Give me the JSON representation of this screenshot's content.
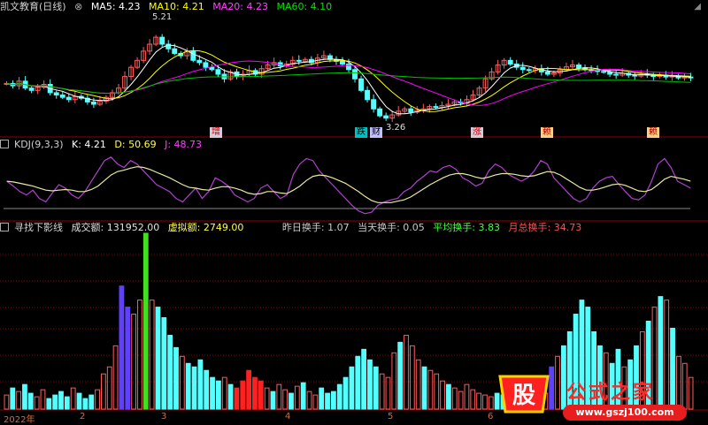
{
  "panel1": {
    "title": "凯文教育(日线)",
    "ma5": "MA5: 4.23",
    "ma10": "MA10: 4.21",
    "ma20": "MA20: 4.23",
    "ma60": "MA60: 4.10",
    "hi_label": "5.21",
    "lo_label": "3.26",
    "badges": [
      "增",
      "跌",
      "财",
      "涨",
      "赖",
      "赖"
    ]
  },
  "panel2": {
    "title": "KDJ(9,3,3)",
    "k": "K: 4.21",
    "d": "D: 50.69",
    "j": "J: 48.73"
  },
  "panel3": {
    "title": "寻找下影线",
    "vol": "成交额: 131952.00",
    "virt": "虚拟额: 2749.00",
    "yday": "昨日换手: 1.07",
    "today": "当天换手: 0.05",
    "avg": "平均换手: 3.83",
    "month": "月总换手: 34.73"
  },
  "xaxis": {
    "labels": [
      "2022年",
      "2",
      "3",
      "4",
      "5",
      "6"
    ]
  },
  "watermark": {
    "brand": "公式之家",
    "url": "www.gszj100.com",
    "logo_char": "股"
  },
  "colors": {
    "bg": "#000000",
    "up": "#ff5c5c",
    "down": "#54ffff",
    "ma5": "#ffffff",
    "ma10": "#ffff00",
    "ma20": "#ff00ff",
    "ma60": "#00c000",
    "grid": "#8b0000",
    "kline": "#b040d0",
    "dline": "#e8e8a0"
  },
  "chart_data": [
    {
      "type": "candlestick",
      "title": "凯文教育(日线)",
      "ylim": [
        3.0,
        5.6
      ],
      "closes": [
        4.1,
        4.05,
        4.15,
        4.0,
        3.95,
        4.02,
        4.08,
        3.9,
        3.85,
        3.8,
        3.75,
        3.82,
        3.78,
        3.7,
        3.65,
        3.72,
        3.8,
        3.9,
        4.0,
        4.25,
        4.45,
        4.6,
        4.8,
        4.95,
        5.1,
        4.95,
        4.85,
        4.75,
        4.7,
        4.8,
        4.6,
        4.55,
        4.45,
        4.4,
        4.3,
        4.2,
        4.35,
        4.25,
        4.3,
        4.38,
        4.3,
        4.42,
        4.5,
        4.55,
        4.48,
        4.52,
        4.6,
        4.58,
        4.62,
        4.55,
        4.65,
        4.7,
        4.62,
        4.58,
        4.52,
        4.4,
        4.2,
        3.95,
        3.75,
        3.55,
        3.4,
        3.35,
        3.42,
        3.5,
        3.55,
        3.48,
        3.52,
        3.55,
        3.6,
        3.58,
        3.62,
        3.65,
        3.7,
        3.68,
        3.75,
        3.85,
        4.0,
        4.2,
        4.35,
        4.5,
        4.6,
        4.52,
        4.45,
        4.4,
        4.38,
        4.42,
        4.35,
        4.3,
        4.33,
        4.4,
        4.46,
        4.5,
        4.44,
        4.4,
        4.38,
        4.36,
        4.35,
        4.3,
        4.28,
        4.32,
        4.28,
        4.26,
        4.3,
        4.28,
        4.25,
        4.28,
        4.24,
        4.26,
        4.22,
        4.24,
        4.23
      ]
    },
    {
      "type": "line",
      "title": "KDJ(9,3,3)",
      "ylim": [
        0,
        100
      ],
      "series": [
        {
          "name": "K",
          "values": [
            55,
            48,
            40,
            35,
            42,
            30,
            25,
            38,
            50,
            45,
            35,
            30,
            40,
            55,
            70,
            85,
            90,
            80,
            75,
            85,
            80,
            70,
            60,
            50,
            45,
            40,
            30,
            25,
            35,
            45,
            30,
            40,
            60,
            55,
            48,
            35,
            30,
            25,
            30,
            45,
            50,
            40,
            30,
            35,
            65,
            80,
            88,
            85,
            70,
            60,
            50,
            40,
            30,
            20,
            12,
            8,
            10,
            20,
            25,
            28,
            30,
            40,
            45,
            55,
            62,
            70,
            68,
            75,
            78,
            72,
            60,
            55,
            48,
            52,
            70,
            80,
            75,
            65,
            60,
            55,
            60,
            70,
            85,
            80,
            60,
            50,
            40,
            30,
            25,
            30,
            45,
            55,
            60,
            62,
            50,
            40,
            30,
            28,
            35,
            55,
            80,
            88,
            75,
            55,
            50,
            45
          ]
        },
        {
          "name": "D",
          "values": [
            55,
            54,
            52,
            50,
            48,
            45,
            42,
            41,
            42,
            43,
            42,
            40,
            40,
            43,
            48,
            56,
            64,
            69,
            71,
            74,
            76,
            75,
            72,
            68,
            64,
            60,
            55,
            50,
            46,
            45,
            43,
            42,
            45,
            47,
            47,
            45,
            42,
            38,
            36,
            37,
            40,
            40,
            38,
            37,
            42,
            48,
            56,
            62,
            64,
            63,
            60,
            56,
            52,
            46,
            40,
            33,
            27,
            24,
            24,
            24,
            26,
            28,
            32,
            38,
            44,
            50,
            55,
            60,
            64,
            66,
            66,
            64,
            61,
            59,
            61,
            64,
            66,
            66,
            65,
            63,
            62,
            63,
            66,
            69,
            68,
            64,
            58,
            52,
            46,
            42,
            42,
            44,
            47,
            50,
            51,
            49,
            45,
            41,
            40,
            43,
            50,
            58,
            62,
            60,
            58,
            55
          ]
        }
      ]
    },
    {
      "type": "bar",
      "title": "寻找下影线",
      "ylim": [
        0,
        100
      ],
      "values": [
        8,
        12,
        10,
        14,
        9,
        7,
        11,
        6,
        8,
        10,
        7,
        12,
        9,
        6,
        8,
        11,
        20,
        24,
        36,
        70,
        58,
        54,
        62,
        100,
        62,
        58,
        52,
        42,
        35,
        30,
        26,
        24,
        28,
        22,
        18,
        16,
        18,
        14,
        12,
        16,
        22,
        18,
        16,
        12,
        10,
        14,
        11,
        9,
        13,
        15,
        10,
        8,
        12,
        9,
        10,
        14,
        18,
        24,
        30,
        34,
        28,
        24,
        20,
        18,
        32,
        38,
        42,
        36,
        28,
        24,
        22,
        20,
        16,
        14,
        12,
        10,
        14,
        11,
        9,
        8,
        7,
        9,
        8,
        10,
        12,
        9,
        11,
        8,
        10,
        9,
        24,
        30,
        36,
        44,
        54,
        62,
        58,
        44,
        36,
        32,
        26,
        34,
        24,
        28,
        36,
        44,
        50,
        58,
        64,
        62,
        46,
        30,
        26,
        18
      ]
    }
  ]
}
